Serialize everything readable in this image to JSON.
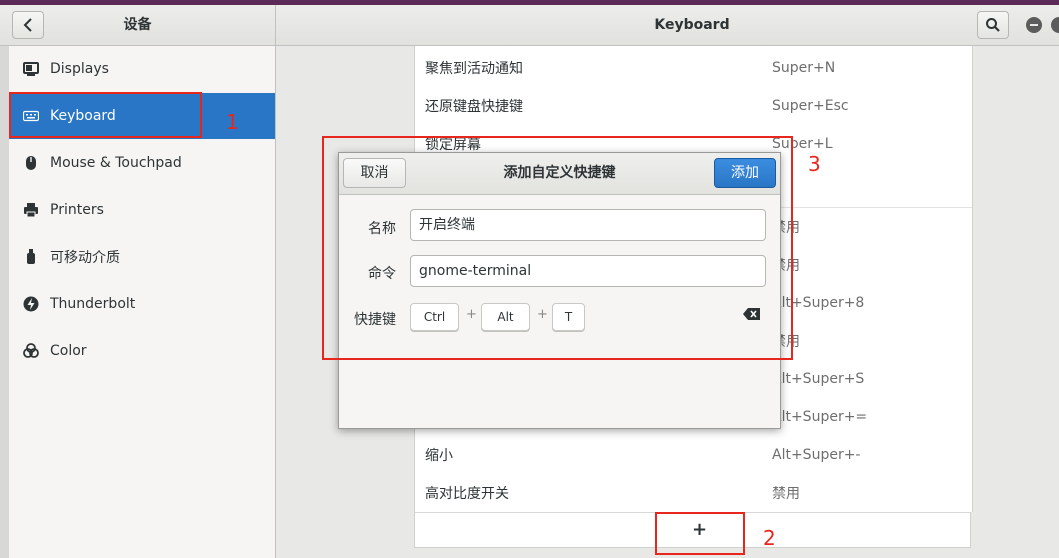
{
  "header": {
    "left_title": "设备",
    "title": "Keyboard"
  },
  "sidebar": {
    "items": [
      {
        "label": "Displays",
        "icon": "display-icon",
        "active": false
      },
      {
        "label": "Keyboard",
        "icon": "keyboard-icon",
        "active": true
      },
      {
        "label": "Mouse & Touchpad",
        "icon": "mouse-icon",
        "active": false
      },
      {
        "label": "Printers",
        "icon": "printer-icon",
        "active": false
      },
      {
        "label": "可移动介质",
        "icon": "usb-icon",
        "active": false
      },
      {
        "label": "Thunderbolt",
        "icon": "thunderbolt-icon",
        "active": false
      },
      {
        "label": "Color",
        "icon": "color-icon",
        "active": false
      }
    ]
  },
  "shortcuts": {
    "rows": [
      {
        "name": "聚焦到活动通知",
        "key": "Super+N"
      },
      {
        "name": "还原键盘快捷键",
        "key": "Super+Esc"
      },
      {
        "name": "锁定屏幕",
        "key": "Super+L"
      },
      {
        "name": "",
        "key": ""
      },
      {
        "name": "",
        "key": "禁用"
      },
      {
        "name": "",
        "key": "禁用"
      },
      {
        "name": "",
        "key": "Alt+Super+8"
      },
      {
        "name": "",
        "key": "禁用"
      },
      {
        "name": "",
        "key": "Alt+Super+S"
      },
      {
        "name": "",
        "key": "Alt+Super+="
      },
      {
        "name": "缩小",
        "key": "Alt+Super+-"
      },
      {
        "name": "高对比度开关",
        "key": "禁用"
      }
    ],
    "add_label": "+"
  },
  "dialog": {
    "title": "添加自定义快捷键",
    "cancel_label": "取消",
    "add_label": "添加",
    "name_label": "名称",
    "name_value": "开启终端",
    "command_label": "命令",
    "command_value": "gnome-terminal",
    "shortcut_label": "快捷键",
    "keys": [
      "Ctrl",
      "Alt",
      "T"
    ],
    "key_separator": "+"
  },
  "annotations": [
    "1",
    "2",
    "3"
  ],
  "colors": {
    "accent": "#2a76c6",
    "annotation": "#e7271d"
  }
}
